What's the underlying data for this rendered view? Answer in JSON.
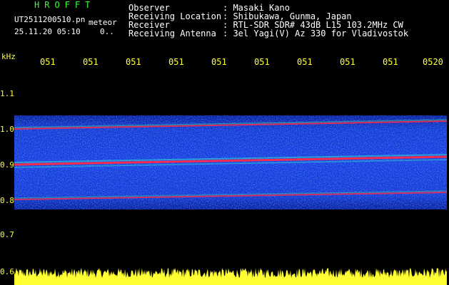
{
  "header": {
    "app": "HROFFT",
    "file": "UT2511200510.pn",
    "meteor_label": "meteor",
    "date_time": "25.11.20 05:10",
    "count": "0.."
  },
  "info": [
    {
      "label": "Observer",
      "value": ": Masaki Kano"
    },
    {
      "label": "Receiving Location",
      "value": ": Shibukawa, Gunma, Japan"
    },
    {
      "label": "Receiver",
      "value": ": RTL-SDR SDR# 43dB L15 103.2MHz CW"
    },
    {
      "label": "Receiving Antenna",
      "value": ": 3el Yagi(V) Az 330 for Vladivostok"
    }
  ],
  "axes": {
    "y_unit": "kHz",
    "y_ticks": [
      "1.1",
      "1.0",
      "0.9",
      "0.8",
      "0.7",
      "0.6"
    ],
    "x_ticks": [
      "051",
      "051",
      "051",
      "051",
      "051",
      "051",
      "051",
      "051",
      "051",
      "0520"
    ]
  },
  "colors": {
    "bg": "#000000",
    "noise": "#1b2bd6",
    "signal": "#ff2a4a",
    "axis": "#ffff33"
  }
}
